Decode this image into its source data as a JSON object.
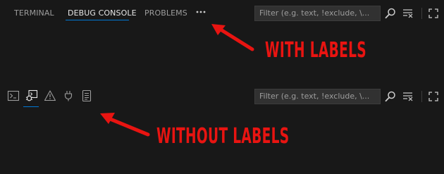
{
  "panel_with_labels": {
    "tabs": [
      {
        "label": "TERMINAL",
        "active": false
      },
      {
        "label": "DEBUG CONSOLE",
        "active": true
      },
      {
        "label": "PROBLEMS",
        "active": false
      }
    ],
    "more_icon": "ellipsis-icon",
    "filter": {
      "placeholder": "Filter (e.g. text, !exclude, \\..."
    }
  },
  "panel_without_labels": {
    "tabs": [
      {
        "icon": "terminal-icon",
        "active": false
      },
      {
        "icon": "debug-console-icon",
        "active": true
      },
      {
        "icon": "warning-icon",
        "active": false
      },
      {
        "icon": "plug-icon",
        "active": false
      },
      {
        "icon": "output-icon",
        "active": false
      }
    ],
    "filter": {
      "placeholder": "Filter (e.g. text, !exclude, \\..."
    }
  },
  "toolbar_icons": [
    "search-icon",
    "clear-console-icon",
    "maximize-icon"
  ],
  "annotations": {
    "with_labels": "WITH LABELS",
    "without_labels": "WITHOUT LABELS"
  },
  "colors": {
    "background": "#181818",
    "tab_inactive": "#9d9d9d",
    "tab_active": "#e7e7e7",
    "accent": "#0078d4",
    "annotation": "#e81411"
  }
}
